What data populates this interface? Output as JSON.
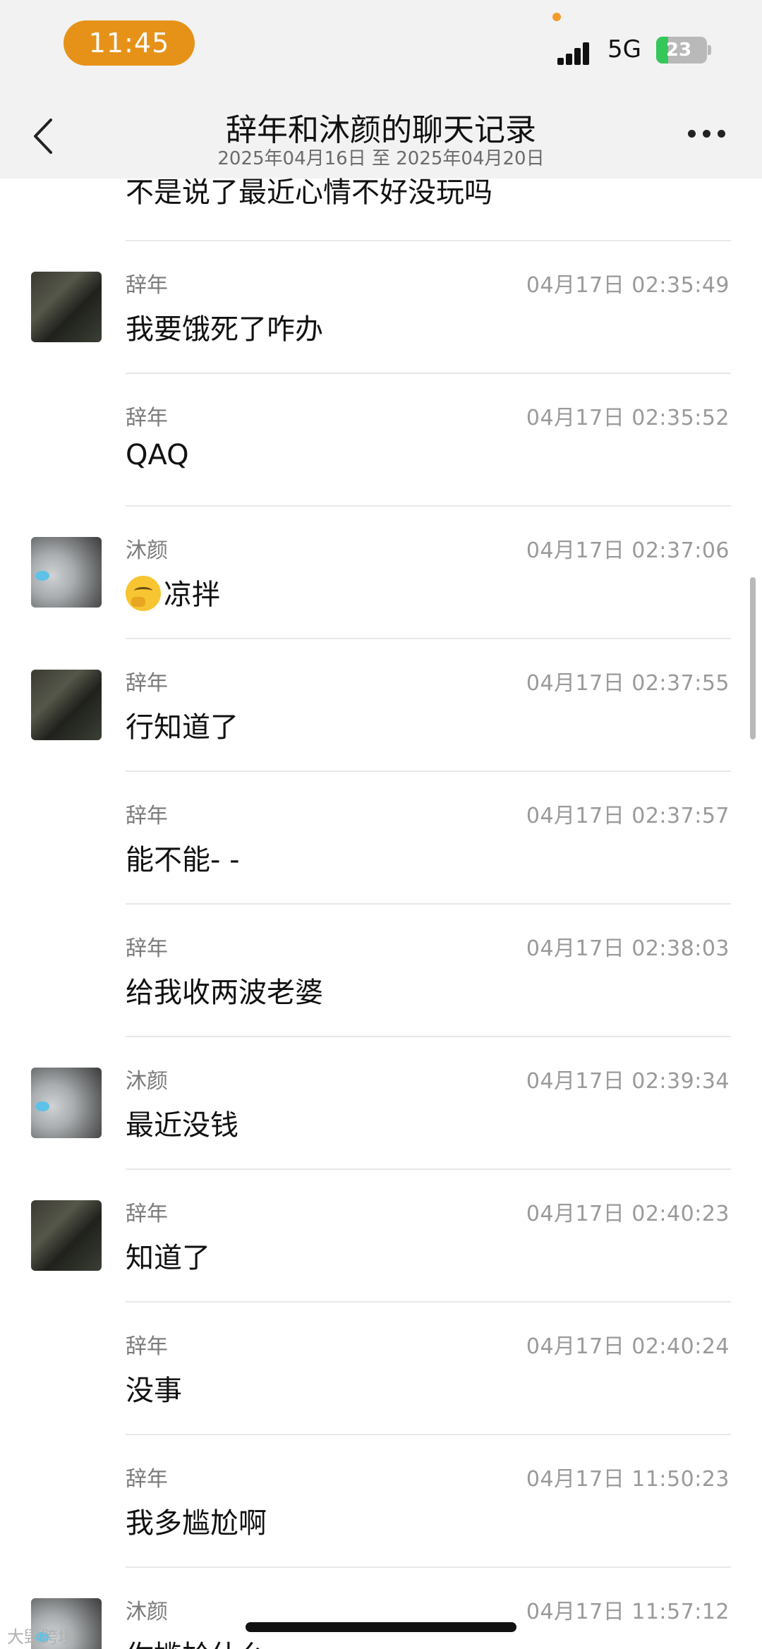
{
  "status_bar": {
    "time": "11:45",
    "network": "5G",
    "battery": "23",
    "battery_percent": 23,
    "accent_color": "#e69219"
  },
  "header": {
    "title": "辞年和沐颜的聊天记录",
    "subtitle": "2025年04月16日 至 2025年04月20日"
  },
  "partial_message": {
    "text": "不是说了最近心情不好没玩吗"
  },
  "messages": [
    {
      "sender": "辞年",
      "time": "04月17日 02:35:49",
      "text": "我要饿死了咋办",
      "avatar": "dark"
    },
    {
      "sender": "辞年",
      "time": "04月17日 02:35:52",
      "text": "QAQ",
      "avatar": ""
    },
    {
      "sender": "沐颜",
      "time": "04月17日 02:37:06",
      "text": "凉拌",
      "emoji": "thinking-face",
      "avatar": "light"
    },
    {
      "sender": "辞年",
      "time": "04月17日 02:37:55",
      "text": "行知道了",
      "avatar": "dark"
    },
    {
      "sender": "辞年",
      "time": "04月17日 02:37:57",
      "text": "能不能- -",
      "avatar": ""
    },
    {
      "sender": "辞年",
      "time": "04月17日 02:38:03",
      "text": "给我收两波老婆",
      "avatar": ""
    },
    {
      "sender": "沐颜",
      "time": "04月17日 02:39:34",
      "text": "最近没钱",
      "avatar": "light"
    },
    {
      "sender": "辞年",
      "time": "04月17日 02:40:23",
      "text": "知道了",
      "avatar": "dark"
    },
    {
      "sender": "辞年",
      "time": "04月17日 02:40:24",
      "text": "没事",
      "avatar": ""
    },
    {
      "sender": "辞年",
      "time": "04月17日 11:50:23",
      "text": "我多尴尬啊",
      "avatar": ""
    },
    {
      "sender": "沐颜",
      "time": "04月17日 11:57:12",
      "text": "你尴尬什么",
      "avatar": "light"
    }
  ],
  "watermark": "大毁跨境"
}
